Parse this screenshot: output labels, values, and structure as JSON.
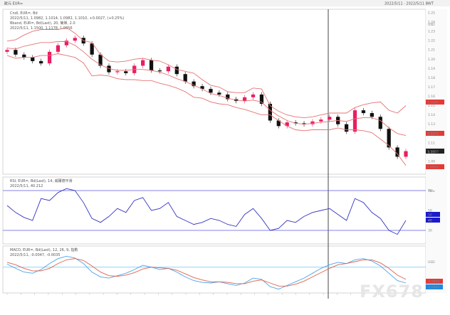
{
  "header": {
    "left": "歐元 EUR=",
    "right": "2022/5/11 · 2022/5/11 BWT"
  },
  "badges": {
    "main": [
      "1.1985",
      "1.1178",
      "1.1010",
      "1.0935"
    ],
    "rsi": [
      "50",
      "40"
    ],
    "macd": [
      "-0.0035",
      "-0.0047"
    ]
  },
  "watermark": "FX678",
  "chart_data": [
    {
      "type": "line",
      "panel": "price",
      "title": "Cndl, EUR=, Bd",
      "subtitle": "2022/5/11, 1.0982, 1.1014, 1.0982, 1.1010, +0.0027, (+0.25%)",
      "legend_line2": "Bband, EUR=, Bd(Last), 20, 簡單, 2.0",
      "legend_line3": "2022/5/11, 1.1500, 1.1178, 1.0856",
      "unit_label": "USD",
      "ylim": [
        1.08,
        1.25
      ],
      "yticks": [
        1.25,
        1.24,
        1.23,
        1.22,
        1.21,
        1.2,
        1.19,
        1.18,
        1.17,
        1.16,
        1.15,
        1.14,
        1.13,
        1.12,
        1.11,
        1.1,
        1.09
      ],
      "series": [
        {
          "name": "Close",
          "values": [
            1.21,
            1.205,
            1.202,
            1.198,
            1.1955,
            1.208,
            1.215,
            1.22,
            1.223,
            1.217,
            1.205,
            1.193,
            1.186,
            1.187,
            1.185,
            1.193,
            1.199,
            1.188,
            1.187,
            1.192,
            1.184,
            1.176,
            1.171,
            1.168,
            1.164,
            1.162,
            1.157,
            1.155,
            1.159,
            1.162,
            1.152,
            1.134,
            1.128,
            1.132,
            1.131,
            1.13,
            1.133,
            1.135,
            1.138,
            1.13,
            1.122,
            1.145,
            1.142,
            1.138,
            1.125,
            1.105,
            1.095,
            1.101
          ]
        },
        {
          "name": "Upper Band",
          "values": [
            1.2195,
            1.221,
            1.226,
            1.23,
            1.232,
            1.232,
            1.232,
            1.234,
            1.228,
            1.22,
            1.218,
            1.205,
            1.198,
            1.197,
            1.198,
            1.2,
            1.201,
            1.199,
            1.198,
            1.194,
            1.189,
            1.187,
            1.185,
            1.178,
            1.172,
            1.17,
            1.165,
            1.164,
            1.164,
            1.169,
            1.168,
            1.15,
            1.144,
            1.14,
            1.138,
            1.137,
            1.138,
            1.14,
            1.142,
            1.142,
            1.142,
            1.148,
            1.151,
            1.153,
            1.154,
            1.145,
            1.142,
            1.15
          ]
        },
        {
          "name": "Middle Band",
          "values": [
            1.212,
            1.211,
            1.214,
            1.216,
            1.218,
            1.218,
            1.219,
            1.219,
            1.215,
            1.208,
            1.2,
            1.194,
            1.19,
            1.188,
            1.188,
            1.189,
            1.189,
            1.188,
            1.186,
            1.183,
            1.179,
            1.176,
            1.172,
            1.168,
            1.163,
            1.161,
            1.158,
            1.156,
            1.155,
            1.156,
            1.154,
            1.145,
            1.139,
            1.134,
            1.131,
            1.13,
            1.131,
            1.132,
            1.133,
            1.134,
            1.133,
            1.136,
            1.137,
            1.137,
            1.134,
            1.126,
            1.12,
            1.1178
          ]
        },
        {
          "name": "Lower Band",
          "values": [
            1.204,
            1.201,
            1.202,
            1.202,
            1.204,
            1.204,
            1.206,
            1.204,
            1.202,
            1.196,
            1.182,
            1.183,
            1.182,
            1.179,
            1.178,
            1.178,
            1.177,
            1.177,
            1.174,
            1.172,
            1.169,
            1.165,
            1.159,
            1.158,
            1.154,
            1.152,
            1.151,
            1.148,
            1.146,
            1.143,
            1.14,
            1.14,
            1.134,
            1.128,
            1.124,
            1.123,
            1.124,
            1.124,
            1.124,
            1.126,
            1.124,
            1.124,
            1.123,
            1.121,
            1.114,
            1.107,
            1.098,
            1.0856
          ]
        }
      ]
    },
    {
      "type": "line",
      "panel": "rsi",
      "title": "RSI, EUR=, Bd(Last), 14, 威爾德平滑",
      "subtitle": "2022/5/11, 40.212",
      "unit_label": "Valu",
      "ylim": [
        20,
        80
      ],
      "yticks": [
        70,
        50,
        40,
        30
      ],
      "reference_lines": [
        70,
        30
      ],
      "series": [
        {
          "name": "RSI",
          "values": [
            55,
            48,
            43,
            40,
            62,
            60,
            68,
            72,
            70,
            58,
            42,
            38,
            44,
            52,
            48,
            60,
            63,
            50,
            52,
            58,
            44,
            40,
            36,
            38,
            42,
            40,
            36,
            34,
            46,
            52,
            42,
            30,
            32,
            40,
            38,
            44,
            48,
            50,
            52,
            46,
            40,
            62,
            58,
            48,
            42,
            30,
            26,
            40
          ]
        }
      ]
    },
    {
      "type": "line",
      "panel": "macd",
      "title": "MACD, EUR=, Bd(Last), 12, 26, 9, 指數",
      "subtitle": "2022/5/11, -0.0047, -0.0035",
      "unit_label": "USD",
      "ylim": [
        -0.04,
        0.03
      ],
      "reference_lines": [
        0
      ],
      "series": [
        {
          "name": "MACD",
          "values": [
            0.005,
            -0.002,
            -0.008,
            -0.01,
            -0.004,
            0.006,
            0.014,
            0.018,
            0.015,
            0.006,
            -0.008,
            -0.016,
            -0.018,
            -0.014,
            -0.01,
            -0.004,
            0.003,
            0.0,
            -0.004,
            -0.002,
            -0.008,
            -0.016,
            -0.022,
            -0.025,
            -0.026,
            -0.024,
            -0.027,
            -0.03,
            -0.026,
            -0.018,
            -0.02,
            -0.032,
            -0.036,
            -0.03,
            -0.024,
            -0.018,
            -0.01,
            -0.002,
            0.004,
            0.008,
            0.006,
            0.012,
            0.014,
            0.01,
            0.002,
            -0.01,
            -0.022,
            -0.026
          ]
        },
        {
          "name": "Signal",
          "values": [
            0.008,
            0.004,
            -0.002,
            -0.006,
            -0.006,
            -0.002,
            0.006,
            0.012,
            0.014,
            0.011,
            0.002,
            -0.008,
            -0.014,
            -0.015,
            -0.013,
            -0.009,
            -0.003,
            0.0,
            -0.001,
            -0.002,
            -0.005,
            -0.011,
            -0.017,
            -0.021,
            -0.024,
            -0.024,
            -0.025,
            -0.027,
            -0.027,
            -0.023,
            -0.021,
            -0.026,
            -0.031,
            -0.031,
            -0.028,
            -0.023,
            -0.016,
            -0.009,
            -0.002,
            0.004,
            0.006,
            0.009,
            0.012,
            0.012,
            0.007,
            -0.002,
            -0.013,
            -0.02
          ]
        }
      ]
    }
  ]
}
